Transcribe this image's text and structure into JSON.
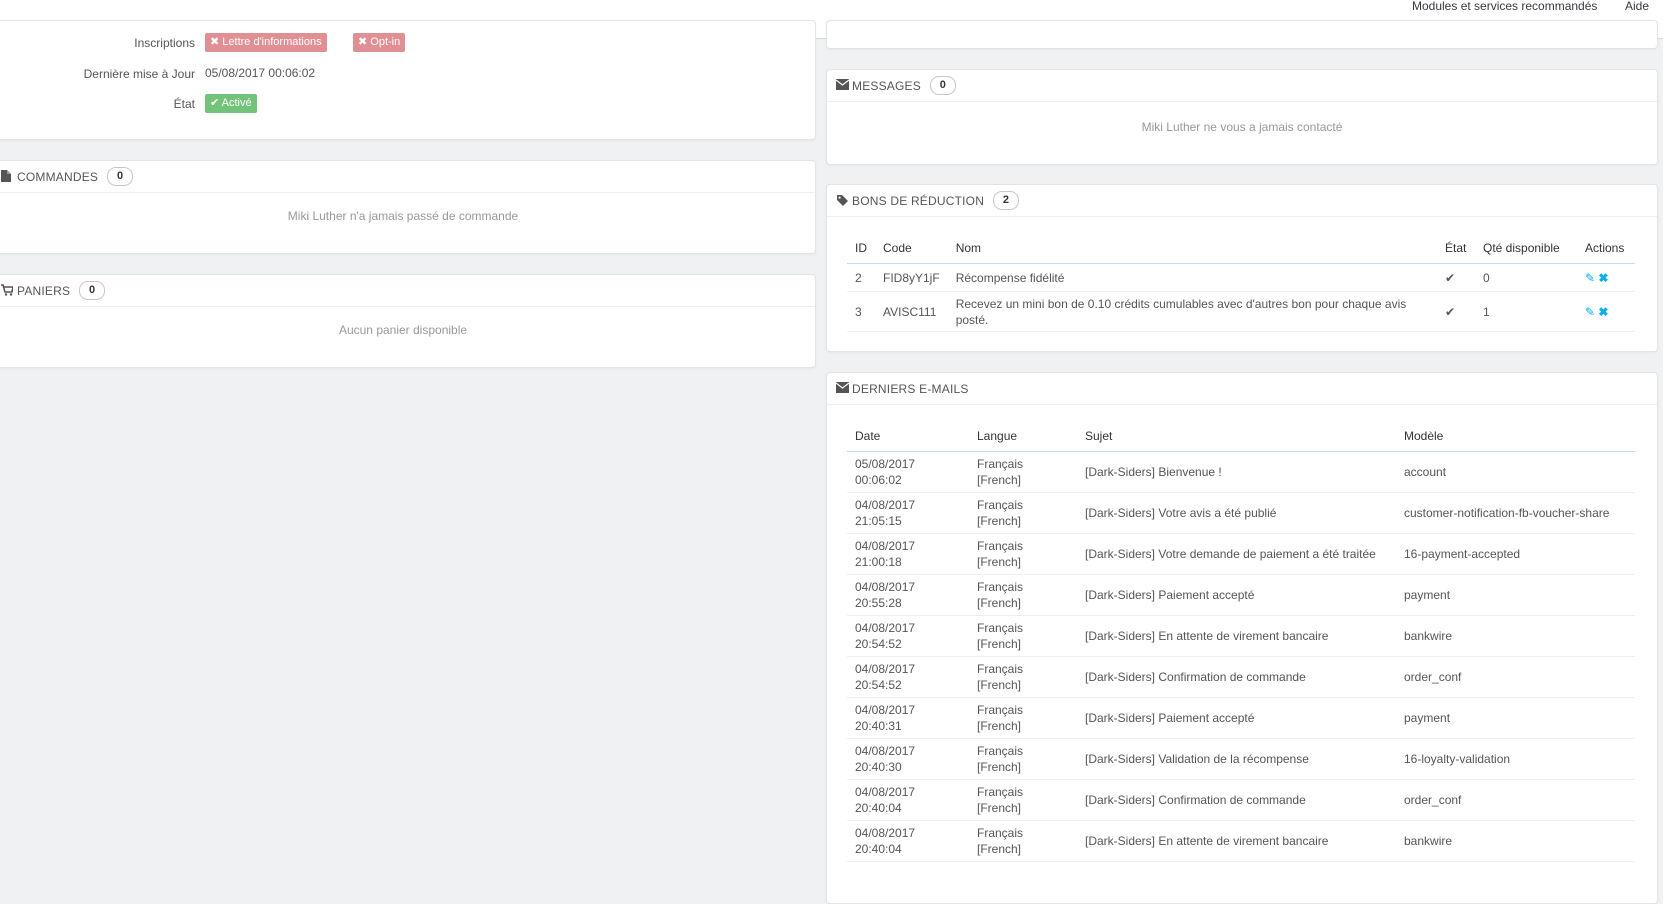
{
  "topbar": {
    "modules_link": "Modules et services recommandés",
    "help_link": "Aide"
  },
  "customer_info": {
    "subscriptions_label": "Inscriptions",
    "badge_newsletter": "✖ Lettre d'informations",
    "badge_optin": "✖ Opt-in",
    "last_update_label": "Dernière mise à Jour",
    "last_update_value": "05/08/2017 00:06:02",
    "state_label": "État",
    "state_value": "✔ Activé"
  },
  "orders": {
    "title": "COMMANDES",
    "count": "0",
    "empty": "Miki Luther n'a jamais passé de commande"
  },
  "carts": {
    "title": "PANIERS",
    "count": "0",
    "empty": "Aucun panier disponible"
  },
  "messages": {
    "title": "MESSAGES",
    "count": "0",
    "empty": "Miki Luther ne vous a jamais contacté"
  },
  "vouchers": {
    "title": "BONS DE RÉDUCTION",
    "count": "2",
    "headers": [
      "ID",
      "Code",
      "Nom",
      "État",
      "Qté disponible",
      "Actions"
    ],
    "rows": [
      {
        "id": "2",
        "code": "FID8yY1jF",
        "name": "Récompense fidélité",
        "qty": "0"
      },
      {
        "id": "3",
        "code": "AVISC111",
        "name": "Recevez un mini bon de 0.10 crédits cumulables avec d'autres bon pour chaque avis posté.",
        "qty": "1"
      }
    ]
  },
  "emails": {
    "title": "DERNIERS E-MAILS",
    "headers": [
      "Date",
      "Langue",
      "Sujet",
      "Modèle"
    ],
    "rows": [
      {
        "date": "05/08/2017",
        "time": "00:06:02",
        "lang": "Français",
        "lang2": "[French]",
        "subject": "[Dark-Siders] Bienvenue !",
        "template": "account"
      },
      {
        "date": "04/08/2017",
        "time": "21:05:15",
        "lang": "Français",
        "lang2": "[French]",
        "subject": "[Dark-Siders] Votre avis a été publié",
        "template": "customer-notification-fb-voucher-share"
      },
      {
        "date": "04/08/2017",
        "time": "21:00:18",
        "lang": "Français",
        "lang2": "[French]",
        "subject": "[Dark-Siders] Votre demande de paiement a été traitée",
        "template": "16-payment-accepted"
      },
      {
        "date": "04/08/2017",
        "time": "20:55:28",
        "lang": "Français",
        "lang2": "[French]",
        "subject": "[Dark-Siders] Paiement accepté",
        "template": "payment"
      },
      {
        "date": "04/08/2017",
        "time": "20:54:52",
        "lang": "Français",
        "lang2": "[French]",
        "subject": "[Dark-Siders] En attente de virement bancaire",
        "template": "bankwire"
      },
      {
        "date": "04/08/2017",
        "time": "20:54:52",
        "lang": "Français",
        "lang2": "[French]",
        "subject": "[Dark-Siders] Confirmation de commande",
        "template": "order_conf"
      },
      {
        "date": "04/08/2017",
        "time": "20:40:31",
        "lang": "Français",
        "lang2": "[French]",
        "subject": "[Dark-Siders] Paiement accepté",
        "template": "payment"
      },
      {
        "date": "04/08/2017",
        "time": "20:40:30",
        "lang": "Français",
        "lang2": "[French]",
        "subject": "[Dark-Siders] Validation de la récompense",
        "template": "16-loyalty-validation"
      },
      {
        "date": "04/08/2017",
        "time": "20:40:04",
        "lang": "Français",
        "lang2": "[French]",
        "subject": "[Dark-Siders] Confirmation de commande",
        "template": "order_conf"
      },
      {
        "date": "04/08/2017",
        "time": "20:40:04",
        "lang": "Français",
        "lang2": "[French]",
        "subject": "[Dark-Siders] En attente de virement bancaire",
        "template": "bankwire"
      }
    ]
  }
}
